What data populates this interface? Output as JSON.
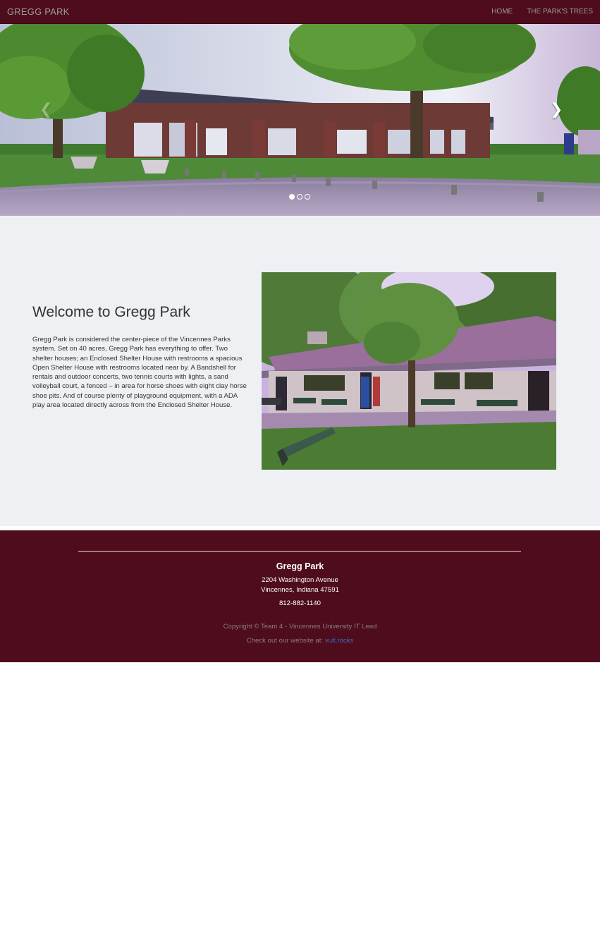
{
  "navbar": {
    "brand": "GREGG PARK",
    "links": [
      "HOME",
      "THE PARK'S TREES"
    ]
  },
  "carousel": {
    "prev_icon": "chevron-left-icon",
    "next_icon": "chevron-right-icon",
    "slide_count": 3,
    "active_slide": 1
  },
  "main": {
    "heading": "Welcome to Gregg Park",
    "body": "Gregg Park is considered the center-piece of the Vincennes Parks system. Set on 40 acres, Gregg Park has everything to offer. Two shelter houses; an Enclosed Shelter House with restrooms a spacious Open Shelter House with restrooms located near by. A Bandshell for rentals and outdoor concerts, two tennis courts with lights, a sand volleyball court, a fenced – in area for horse shoes with eight clay horse shoe pits. And of course plenty of playground equipment, with a ADA play area located directly across from the Enclosed Shelter House."
  },
  "footer": {
    "name": "Gregg Park",
    "address_line1": "2204 Washington Avenue",
    "address_line2": "Vincennes, Indiana 47591",
    "phone": "812-882-1140",
    "copyright": "Copyright © Team 4 - Vincennes University IT Lead",
    "website_prefix": "Check out our website at:",
    "website_link": "vuit.rocks"
  },
  "colors": {
    "brand_maroon": "#4e0c1c",
    "link_blue": "#3b6fc2",
    "content_bg": "#eff0f4"
  }
}
